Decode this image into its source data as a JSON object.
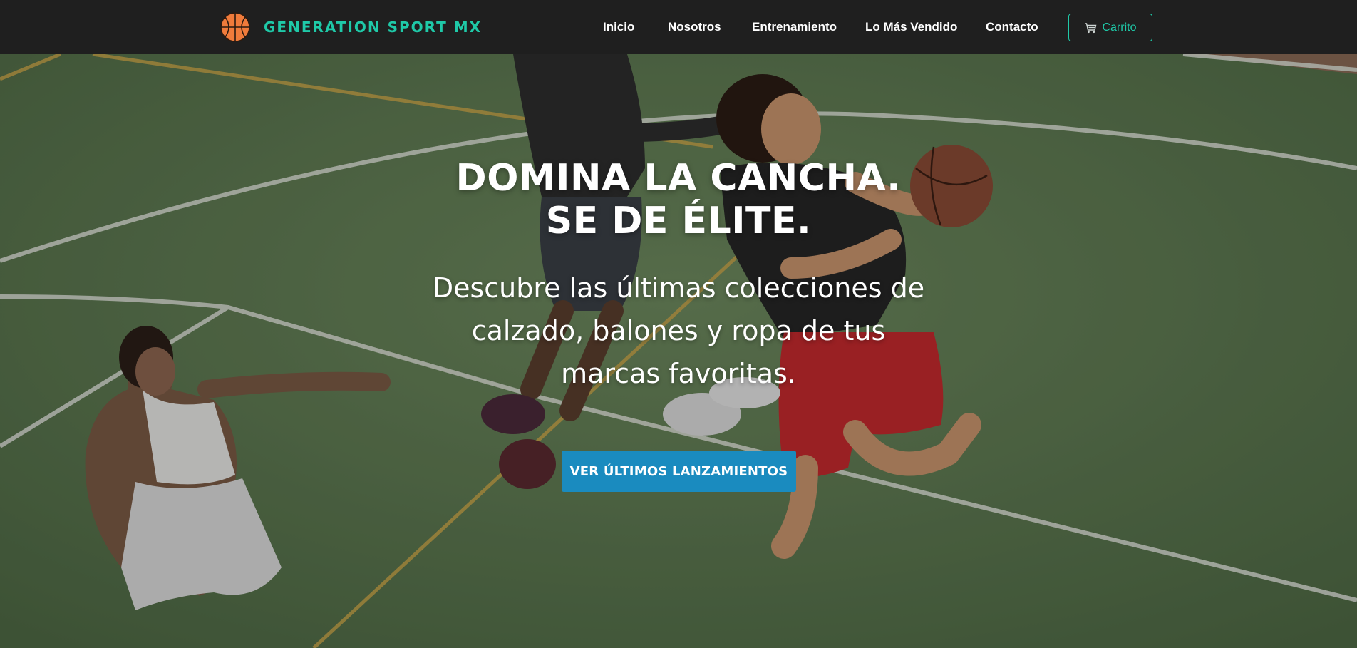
{
  "brand": {
    "name": "GENERATION SPORT MX",
    "logo_icon": "basketball-icon",
    "accent": "#1fc9a8"
  },
  "nav": {
    "items": [
      {
        "label": "Inicio"
      },
      {
        "label": "Nosotros"
      },
      {
        "label": "Entrenamiento"
      },
      {
        "label": "Lo Más Vendido"
      },
      {
        "label": "Contacto"
      }
    ],
    "cart": {
      "label": "Carrito",
      "icon": "shopping-cart-icon"
    }
  },
  "hero": {
    "title_line1": "DOMINA LA CANCHA.",
    "title_line2": "SE DE ÉLITE.",
    "subtitle": "Descubre las últimas colecciones de calzado, balones y ropa de tus marcas favoritas.",
    "cta_label": "VER ÚLTIMOS LANZAMIENTOS",
    "cta_color": "#1a8bbf"
  }
}
